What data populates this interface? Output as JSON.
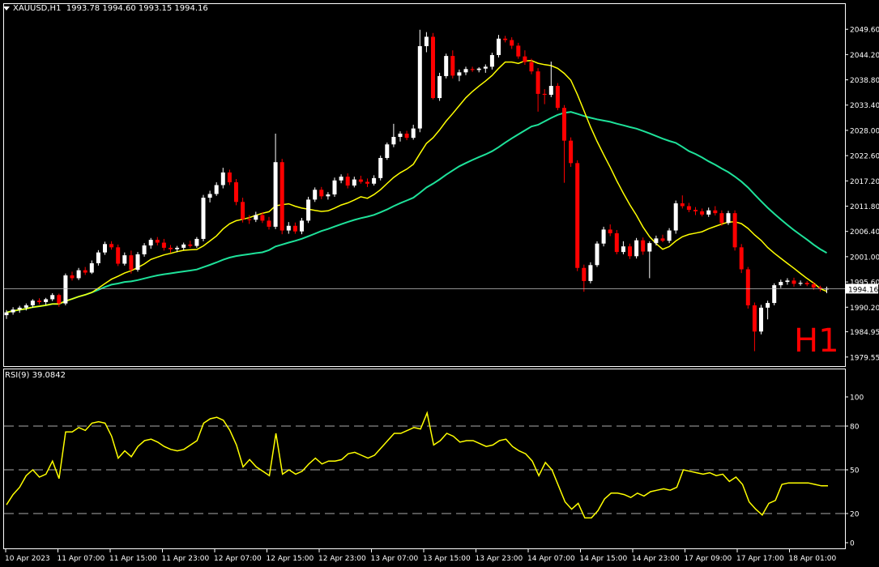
{
  "header": {
    "symbol": "XAUUSD,H1",
    "ohlc": "1993.78 1994.60 1993.15 1994.16"
  },
  "timeframe_badge": "H1",
  "rsi_header": "RSI(9) 39.0842",
  "current_price": "1994.16",
  "colors": {
    "background": "#000000",
    "frame": "#ffffff",
    "bull": "#ffffff",
    "bear": "#ff0000",
    "ma_fast": "#ffff00",
    "ma_slow": "#1ee29a",
    "rsi": "#ffff00",
    "price_line": "#c0c0c0",
    "badge": "#ff0000"
  },
  "chart_data": [
    {
      "type": "candlestick",
      "title": "XAUUSD,H1",
      "ylim": [
        1978.3,
        2052.4
      ],
      "y_ticks": [
        "2049.60",
        "2044.20",
        "2038.80",
        "2033.40",
        "2028.00",
        "2022.60",
        "2017.20",
        "2011.80",
        "2006.40",
        "2001.00",
        "1995.60",
        "1990.20",
        "1984.95",
        "1979.55"
      ],
      "x_ticks": [
        "10 Apr 2023",
        "11 Apr 07:00",
        "11 Apr 15:00",
        "11 Apr 23:00",
        "12 Apr 07:00",
        "12 Apr 15:00",
        "12 Apr 23:00",
        "13 Apr 07:00",
        "13 Apr 15:00",
        "13 Apr 23:00",
        "14 Apr 07:00",
        "14 Apr 15:00",
        "14 Apr 23:00",
        "17 Apr 09:00",
        "17 Apr 17:00",
        "18 Apr 01:00"
      ],
      "last_price": 1994.16,
      "candles": [
        [
          1988.5,
          1989.6,
          1987.7,
          1989.1
        ],
        [
          1989.1,
          1990.2,
          1988.6,
          1989.7
        ],
        [
          1989.7,
          1990.5,
          1989.0,
          1990.1
        ],
        [
          1990.1,
          1991.0,
          1989.5,
          1990.6
        ],
        [
          1990.6,
          1991.9,
          1990.1,
          1991.6
        ],
        [
          1991.6,
          1992.1,
          1990.8,
          1991.3
        ],
        [
          1991.3,
          1992.2,
          1990.7,
          1991.9
        ],
        [
          1991.9,
          1993.2,
          1991.5,
          1992.8
        ],
        [
          1992.8,
          1993.1,
          1990.3,
          1991.0
        ],
        [
          1991.0,
          1997.4,
          1990.6,
          1997.0
        ],
        [
          1997.0,
          1997.8,
          1995.9,
          1996.4
        ],
        [
          1996.4,
          1998.6,
          1996.0,
          1998.1
        ],
        [
          1998.1,
          1998.8,
          1997.1,
          1997.6
        ],
        [
          1997.6,
          2000.2,
          1997.3,
          1999.6
        ],
        [
          1999.6,
          2002.4,
          1999.1,
          2001.9
        ],
        [
          2001.9,
          2004.2,
          2001.4,
          2003.7
        ],
        [
          2003.7,
          2004.3,
          2002.5,
          2003.0
        ],
        [
          2003.0,
          2003.6,
          1999.0,
          1999.5
        ],
        [
          1999.5,
          2001.9,
          1999.1,
          2001.3
        ],
        [
          2001.3,
          2002.3,
          1997.4,
          1998.2
        ],
        [
          1998.2,
          2002.0,
          1997.8,
          2001.5
        ],
        [
          2001.5,
          2003.9,
          2001.0,
          2003.4
        ],
        [
          2003.4,
          2005.0,
          2002.7,
          2004.6
        ],
        [
          2004.6,
          2005.2,
          2003.4,
          2004.0
        ],
        [
          2004.0,
          2004.8,
          2002.3,
          2002.9
        ],
        [
          2002.9,
          2003.5,
          2001.8,
          2002.6
        ],
        [
          2002.6,
          2003.3,
          2002.0,
          2002.9
        ],
        [
          2002.9,
          2004.0,
          2002.4,
          2003.6
        ],
        [
          2003.6,
          2004.4,
          2002.9,
          2003.3
        ],
        [
          2003.3,
          2005.2,
          2002.9,
          2004.8
        ],
        [
          2004.8,
          2014.2,
          2004.3,
          2013.6
        ],
        [
          2013.6,
          2015.1,
          2012.6,
          2014.4
        ],
        [
          2014.4,
          2016.9,
          2014.0,
          2016.3
        ],
        [
          2016.3,
          2020.0,
          2015.6,
          2019.0
        ],
        [
          2019.0,
          2019.6,
          2016.3,
          2016.9
        ],
        [
          2016.9,
          2017.6,
          2012.0,
          2012.7
        ],
        [
          2012.7,
          2013.6,
          2008.3,
          2009.0
        ],
        [
          2009.0,
          2009.9,
          2008.0,
          2008.9
        ],
        [
          2008.9,
          2010.6,
          2008.4,
          2009.9
        ],
        [
          2009.9,
          2010.5,
          2008.2,
          2008.7
        ],
        [
          2008.7,
          2009.5,
          2006.8,
          2007.4
        ],
        [
          2007.4,
          2027.3,
          2006.9,
          2021.2
        ],
        [
          2021.2,
          2021.9,
          2005.8,
          2006.6
        ],
        [
          2006.6,
          2008.4,
          2005.9,
          2007.6
        ],
        [
          2007.6,
          2008.3,
          2005.9,
          2006.4
        ],
        [
          2006.4,
          2009.3,
          2005.8,
          2008.7
        ],
        [
          2008.7,
          2013.8,
          2008.2,
          2013.2
        ],
        [
          2013.2,
          2015.8,
          2012.7,
          2015.3
        ],
        [
          2015.3,
          2015.9,
          2013.3,
          2013.9
        ],
        [
          2013.9,
          2014.8,
          2013.2,
          2014.3
        ],
        [
          2014.3,
          2017.9,
          2013.8,
          2017.3
        ],
        [
          2017.3,
          2018.6,
          2016.7,
          2018.1
        ],
        [
          2018.1,
          2018.8,
          2015.6,
          2016.2
        ],
        [
          2016.2,
          2018.1,
          2015.8,
          2017.5
        ],
        [
          2017.5,
          2018.3,
          2016.6,
          2017.0
        ],
        [
          2017.0,
          2017.7,
          2015.9,
          2016.6
        ],
        [
          2016.6,
          2018.4,
          2016.2,
          2017.8
        ],
        [
          2017.8,
          2022.6,
          2017.3,
          2022.1
        ],
        [
          2022.1,
          2025.4,
          2021.7,
          2025.0
        ],
        [
          2025.0,
          2029.4,
          2024.4,
          2026.6
        ],
        [
          2026.6,
          2027.8,
          2025.6,
          2027.3
        ],
        [
          2027.3,
          2027.9,
          2025.9,
          2026.4
        ],
        [
          2026.4,
          2029.2,
          2026.0,
          2028.4
        ],
        [
          2028.4,
          2049.5,
          2027.6,
          2046.0
        ],
        [
          2046.0,
          2049.0,
          2044.7,
          2048.0
        ],
        [
          2048.0,
          2048.8,
          2034.6,
          2034.9
        ],
        [
          2034.9,
          2040.3,
          2034.3,
          2039.6
        ],
        [
          2039.6,
          2044.4,
          2039.1,
          2043.9
        ],
        [
          2043.9,
          2045.1,
          2039.1,
          2039.7
        ],
        [
          2039.7,
          2041.0,
          2038.5,
          2040.4
        ],
        [
          2040.4,
          2041.6,
          2039.8,
          2041.1
        ],
        [
          2041.1,
          2041.6,
          2040.5,
          2040.9
        ],
        [
          2040.9,
          2041.5,
          2040.4,
          2041.2
        ],
        [
          2041.2,
          2042.1,
          2040.3,
          2041.6
        ],
        [
          2041.6,
          2044.6,
          2041.0,
          2044.1
        ],
        [
          2044.1,
          2048.4,
          2043.6,
          2047.6
        ],
        [
          2047.6,
          2048.2,
          2046.8,
          2047.3
        ],
        [
          2047.3,
          2047.9,
          2045.4,
          2046.1
        ],
        [
          2046.1,
          2046.7,
          2043.3,
          2043.8
        ],
        [
          2043.8,
          2045.1,
          2042.0,
          2042.6
        ],
        [
          2042.6,
          2043.3,
          2040.0,
          2040.6
        ],
        [
          2040.6,
          2041.3,
          2032.0,
          2035.8
        ],
        [
          2035.8,
          2036.8,
          2033.6,
          2035.6
        ],
        [
          2035.6,
          2042.7,
          2035.1,
          2037.5
        ],
        [
          2037.5,
          2038.1,
          2032.3,
          2032.8
        ],
        [
          2032.8,
          2033.4,
          2016.8,
          2025.8
        ],
        [
          2025.8,
          2026.5,
          2020.2,
          2021.0
        ],
        [
          2021.0,
          2021.6,
          1997.9,
          1998.6
        ],
        [
          1998.6,
          1999.3,
          1993.5,
          1995.8
        ],
        [
          1995.8,
          1999.8,
          1995.3,
          1999.2
        ],
        [
          1999.2,
          2004.3,
          1998.8,
          2003.8
        ],
        [
          2003.8,
          2007.4,
          2003.2,
          2006.8
        ],
        [
          2006.8,
          2007.9,
          2005.4,
          2006.0
        ],
        [
          2006.0,
          2006.7,
          2001.5,
          2002.0
        ],
        [
          2002.0,
          2004.3,
          2001.5,
          2003.2
        ],
        [
          2003.2,
          2003.8,
          2000.5,
          2001.1
        ],
        [
          2001.1,
          2005.0,
          2000.6,
          2004.5
        ],
        [
          2004.5,
          2005.1,
          2001.4,
          2002.1
        ],
        [
          2002.1,
          2004.3,
          1996.4,
          2003.9
        ],
        [
          2003.9,
          2005.5,
          2003.4,
          2004.9
        ],
        [
          2004.9,
          2005.7,
          2004.1,
          2004.4
        ],
        [
          2004.4,
          2007.1,
          2003.9,
          2006.6
        ],
        [
          2006.6,
          2013.0,
          2005.9,
          2012.4
        ],
        [
          2012.4,
          2014.1,
          2011.3,
          2011.8
        ],
        [
          2011.8,
          2012.5,
          2010.5,
          2011.0
        ],
        [
          2011.0,
          2011.6,
          2009.9,
          2010.7
        ],
        [
          2010.7,
          2011.3,
          2009.6,
          2010.0
        ],
        [
          2010.0,
          2011.5,
          2009.5,
          2010.9
        ],
        [
          2010.9,
          2011.8,
          2009.8,
          2010.3
        ],
        [
          2010.3,
          2010.9,
          2007.6,
          2008.2
        ],
        [
          2008.2,
          2010.8,
          2007.8,
          2010.3
        ],
        [
          2010.3,
          2010.9,
          2002.3,
          2003.0
        ],
        [
          2003.0,
          2003.7,
          1997.5,
          1998.3
        ],
        [
          1998.3,
          1998.8,
          1989.9,
          1990.6
        ],
        [
          1990.6,
          1991.2,
          1980.8,
          1985.0
        ],
        [
          1985.0,
          1990.7,
          1984.4,
          1990.1
        ],
        [
          1990.1,
          1991.6,
          1987.6,
          1991.1
        ],
        [
          1991.1,
          1995.3,
          1990.6,
          1994.9
        ],
        [
          1994.9,
          1996.1,
          1994.3,
          1995.6
        ],
        [
          1995.6,
          1996.4,
          1995.0,
          1995.9
        ],
        [
          1995.9,
          1996.5,
          1994.6,
          1995.2
        ],
        [
          1995.2,
          1995.9,
          1994.8,
          1995.4
        ],
        [
          1995.4,
          1995.8,
          1994.7,
          1995.1
        ],
        [
          1995.1,
          1995.6,
          1993.9,
          1994.4
        ],
        [
          1994.4,
          1994.8,
          1993.6,
          1994.1
        ],
        [
          1994.0,
          1994.6,
          1993.2,
          1994.2
        ]
      ]
    },
    {
      "type": "line",
      "title": "RSI(9) 39.0842",
      "ylim": [
        0,
        100
      ],
      "y_ticks": [
        "100",
        "80",
        "50",
        "20",
        "0"
      ],
      "levels": [
        80,
        50,
        20
      ],
      "series": [
        {
          "values": [
            26,
            33,
            38,
            46,
            50,
            45,
            47,
            56,
            44,
            76,
            76,
            79,
            77,
            82,
            83,
            82,
            73,
            58,
            63,
            59,
            66,
            70,
            71,
            69,
            66,
            64,
            63,
            64,
            67,
            70,
            82,
            85,
            86,
            84,
            77,
            67,
            52,
            57,
            52,
            49,
            46,
            75,
            47,
            50,
            47,
            49,
            54,
            58,
            54,
            56,
            56,
            57,
            61,
            62,
            60,
            58,
            60,
            65,
            70,
            75,
            75,
            77,
            79,
            78,
            89,
            67,
            70,
            75,
            73,
            69,
            70,
            70,
            68,
            66,
            67,
            70,
            71,
            66,
            63,
            61,
            56,
            46,
            55,
            50,
            39,
            28,
            23,
            27,
            17,
            17,
            22,
            30,
            34,
            34,
            33,
            31,
            34,
            32,
            35,
            36,
            37,
            36,
            38,
            50,
            49,
            48,
            47,
            48,
            46,
            47,
            42,
            45,
            40,
            28,
            23,
            19,
            27,
            29,
            40,
            41,
            41,
            41,
            41,
            40,
            39,
            39
          ]
        }
      ]
    }
  ]
}
